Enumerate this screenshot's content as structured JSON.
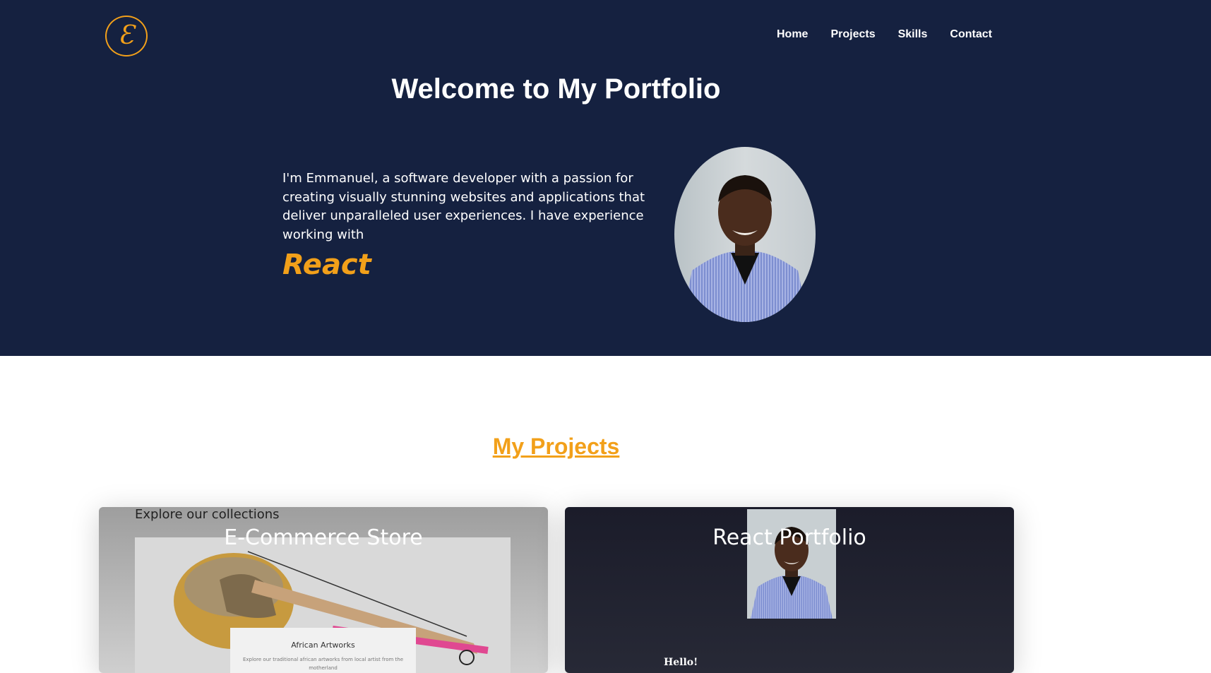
{
  "logo": {
    "glyph": "Ɛ"
  },
  "nav": {
    "items": [
      "Home",
      "Projects",
      "Skills",
      "Contact"
    ]
  },
  "hero": {
    "title": "Welcome to My Portfolio",
    "intro": "I'm Emmanuel, a software developer with a passion for creating visually stunning websites and applications that deliver unparalleled user experiences. I have experience working with",
    "tech": "React"
  },
  "projects": {
    "title": "My Projects",
    "cards": [
      {
        "title": "E-Commerce Store",
        "explore": "Explore our collections",
        "box_title": "African Artworks",
        "box_desc": "Explore our traditional african artworks from local artist from the motherland"
      },
      {
        "title": "React Portfolio",
        "hello": "Hello!"
      }
    ]
  },
  "colors": {
    "navy": "#152140",
    "accent": "#f2a01a",
    "dark_card": "#1b1c2a"
  }
}
